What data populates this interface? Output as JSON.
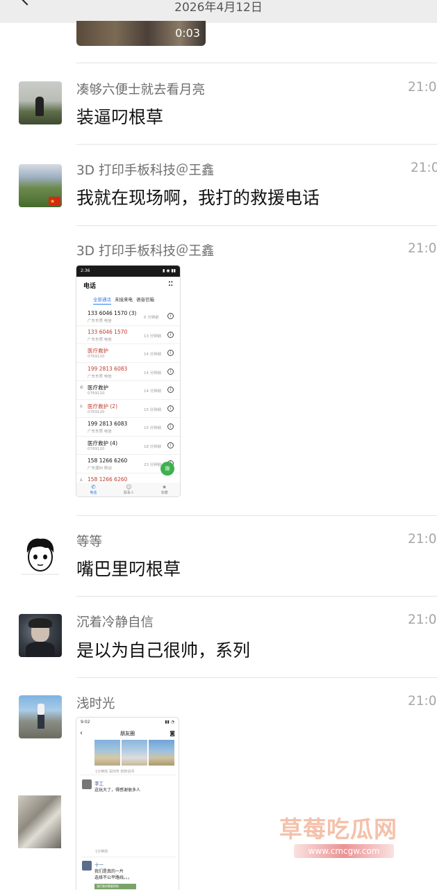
{
  "header": {
    "date": "2026年4月12日"
  },
  "top_video": {
    "duration": "0:03"
  },
  "messages": [
    {
      "name": "凑够六便士就去看月亮",
      "time": "21:0",
      "text": "装逼叼根草"
    },
    {
      "name": "3D 打印手板科技＠王鑫",
      "time": "21:0",
      "text": "我就在现场啊，我打的救援电话"
    },
    {
      "name": "3D 打印手板科技＠王鑫",
      "time": "21:0"
    },
    {
      "name": "等等",
      "time": "21:0",
      "text": "嘴巴里叼根草"
    },
    {
      "name": "沉着冷静自信",
      "time": "21:0",
      "text": "是以为自己很帅，系列"
    },
    {
      "name": "浅时光",
      "time": "21:0"
    }
  ],
  "call_screenshot": {
    "status_time": "2:36",
    "title": "电话",
    "tabs": [
      "全部通话",
      "未接来电",
      "语音信箱"
    ],
    "rows": [
      {
        "number": "133 6046 1570 (3)",
        "sub": "广东东莞 电信",
        "when": "6 分钟前",
        "missed": false,
        "lead": ""
      },
      {
        "number": "133 6046 1570",
        "sub": "广东东莞 电信",
        "when": "13 分钟前",
        "missed": true,
        "lead": ""
      },
      {
        "number": "医疗救护",
        "sub": "0769120",
        "when": "14 分钟前",
        "missed": true,
        "lead": ""
      },
      {
        "number": "199 2813 6083",
        "sub": "广东东莞 电信",
        "when": "14 分钟前",
        "missed": true,
        "lead": ""
      },
      {
        "number": "医疗救护",
        "sub": "0769120",
        "when": "14 分钟前",
        "missed": false,
        "lead": "✆"
      },
      {
        "number": "医疗救护 (2)",
        "sub": "0769120",
        "when": "15 分钟前",
        "missed": true,
        "lead": "⅄"
      },
      {
        "number": "199 2813 6083",
        "sub": "广东东莞 电信",
        "when": "15 分钟前",
        "missed": false,
        "lead": ""
      },
      {
        "number": "医疗救护 (4)",
        "sub": "0769120",
        "when": "18 分钟前",
        "missed": false,
        "lead": ""
      },
      {
        "number": "158 1266 6260",
        "sub": "广东潮州 移动",
        "when": "23 分钟前",
        "missed": false,
        "lead": ""
      },
      {
        "number": "158 1266 6260",
        "sub": "",
        "when": "",
        "missed": true,
        "lead": "⅄"
      }
    ],
    "fab_label": "拨",
    "nav": [
      "电话",
      "联系人",
      "收藏"
    ]
  },
  "moments_screenshot": {
    "status_time": "9:02",
    "title": "朋友圈",
    "caption": "1分钟前  深圳市  授权访问",
    "post1": {
      "name": "李工",
      "text": "这玩大了，得感谢很多人",
      "time": "1分钟前"
    },
    "post2": {
      "name": "十一",
      "line1": "我们是真的一片",
      "line2": "选择不公平路线。。。",
      "tag": "我们真的需要帮助"
    }
  },
  "watermark": {
    "title": "草莓吃瓜网",
    "url": "www.cmcgw.com"
  }
}
